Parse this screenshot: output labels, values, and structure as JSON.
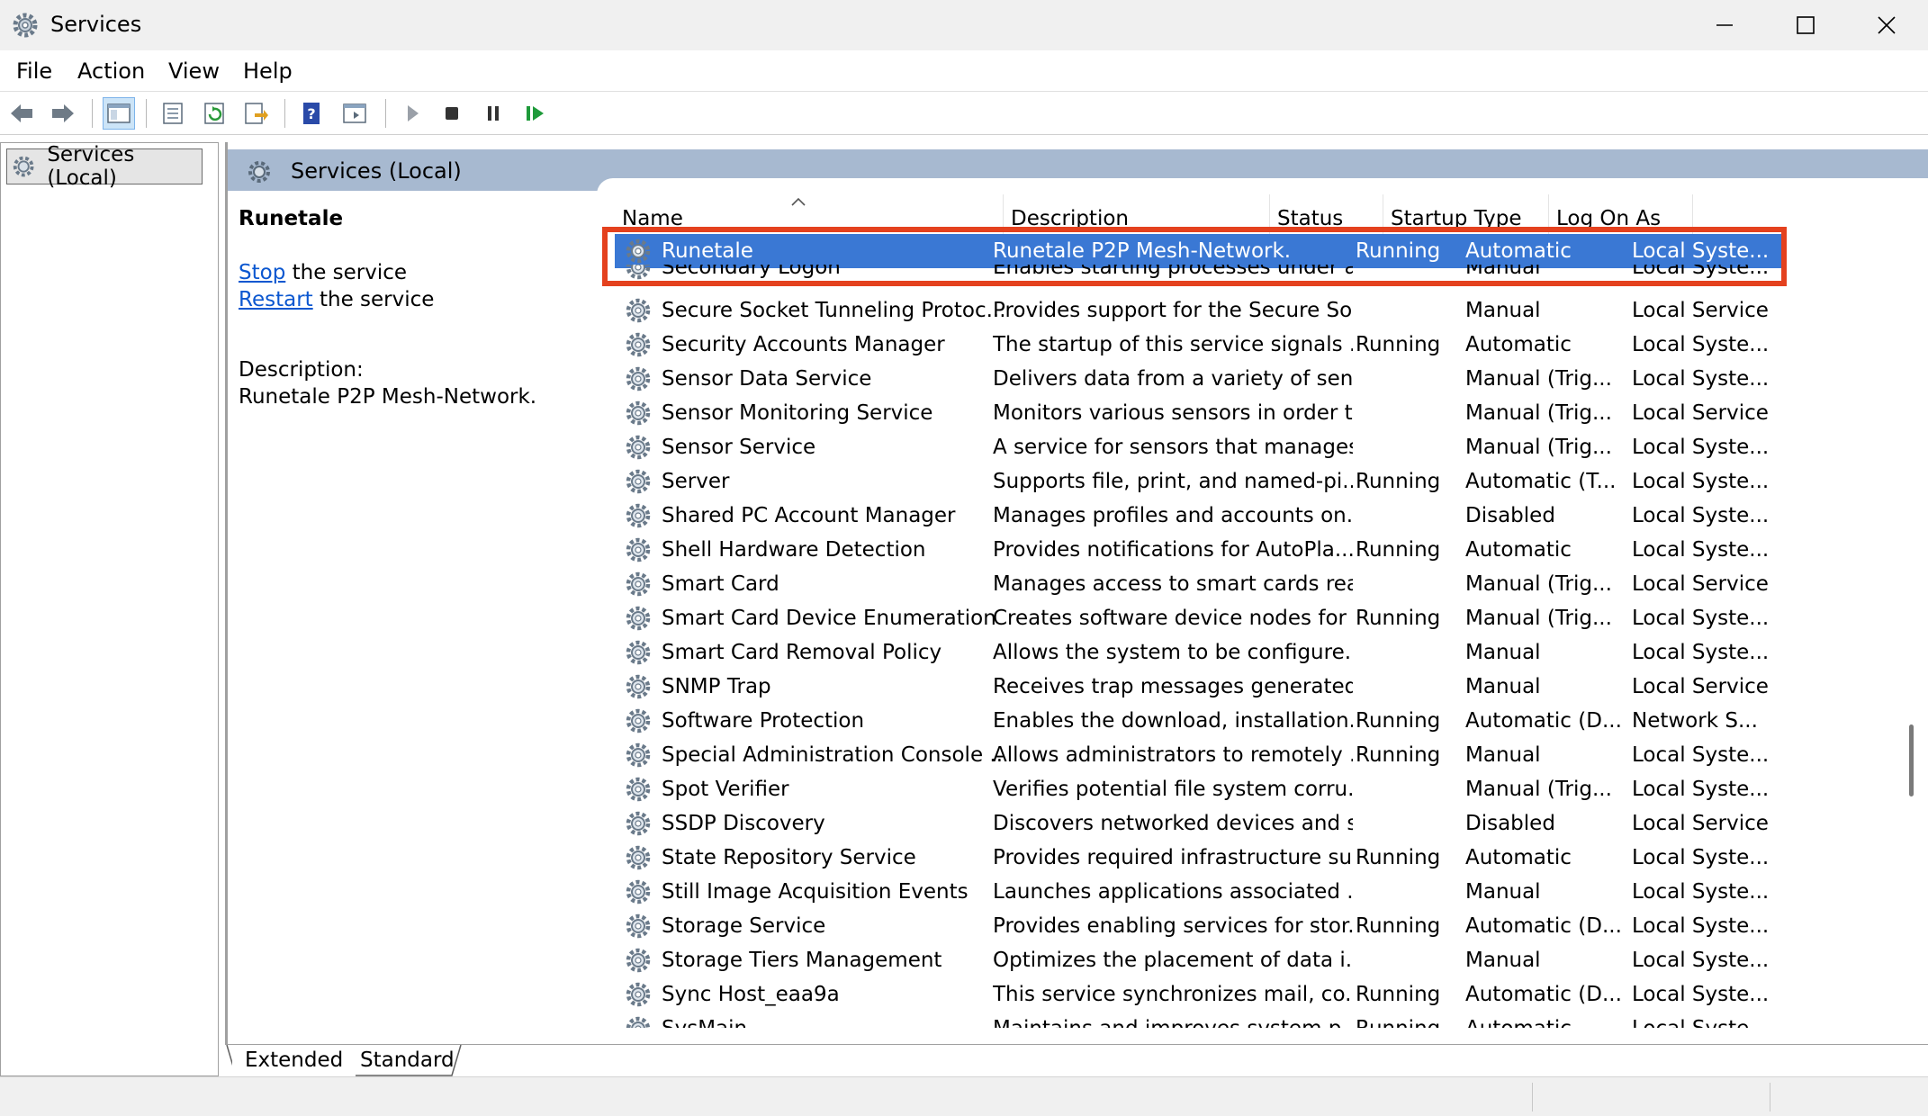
{
  "window": {
    "title": "Services",
    "icon": "services-gear-icon",
    "controls": [
      "minimize-icon",
      "maximize-icon",
      "close-icon"
    ]
  },
  "menu": [
    "File",
    "Action",
    "View",
    "Help"
  ],
  "toolbar": {
    "buttons": [
      "back-icon",
      "forward-icon",
      "show-console-tree-icon",
      "properties-icon",
      "refresh-icon",
      "export-list-icon",
      "help-icon",
      "console-view-icon",
      "start-service-icon",
      "stop-service-icon",
      "pause-service-icon",
      "resume-service-icon"
    ]
  },
  "tree": {
    "root_label": "Services (Local)"
  },
  "panel": {
    "header_title": "Services (Local)",
    "selected_name": "Runetale",
    "action_stop_link": "Stop",
    "action_stop_suffix": " the service",
    "action_restart_link": "Restart",
    "action_restart_suffix": " the service",
    "description_label": "Description:",
    "description_text": "Runetale P2P Mesh-Network."
  },
  "columns": {
    "name": "Name",
    "description": "Description",
    "status": "Status",
    "startup_type": "Startup Type",
    "log_on_as": "Log On As"
  },
  "services": [
    {
      "name": "Runetale",
      "description": "Runetale P2P Mesh-Network.",
      "status": "Running",
      "startup": "Automatic",
      "logon": "Local Syste...",
      "selected": true
    },
    {
      "name": "Secondary Logon",
      "description": "Enables starting processes under a...",
      "status": "",
      "startup": "Manual",
      "logon": "Local Syste...",
      "cut": true
    },
    {
      "name": "Secure Socket Tunneling Protoc...",
      "description": "Provides support for the Secure So...",
      "status": "",
      "startup": "Manual",
      "logon": "Local Service"
    },
    {
      "name": "Security Accounts Manager",
      "description": "The startup of this service signals ...",
      "status": "Running",
      "startup": "Automatic",
      "logon": "Local Syste..."
    },
    {
      "name": "Sensor Data Service",
      "description": "Delivers data from a variety of sen...",
      "status": "",
      "startup": "Manual (Trig...",
      "logon": "Local Syste..."
    },
    {
      "name": "Sensor Monitoring Service",
      "description": "Monitors various sensors in order t...",
      "status": "",
      "startup": "Manual (Trig...",
      "logon": "Local Service"
    },
    {
      "name": "Sensor Service",
      "description": "A service for sensors that manages...",
      "status": "",
      "startup": "Manual (Trig...",
      "logon": "Local Syste..."
    },
    {
      "name": "Server",
      "description": "Supports file, print, and named-pi...",
      "status": "Running",
      "startup": "Automatic (T...",
      "logon": "Local Syste..."
    },
    {
      "name": "Shared PC Account Manager",
      "description": "Manages profiles and accounts on...",
      "status": "",
      "startup": "Disabled",
      "logon": "Local Syste..."
    },
    {
      "name": "Shell Hardware Detection",
      "description": "Provides notifications for AutoPla...",
      "status": "Running",
      "startup": "Automatic",
      "logon": "Local Syste..."
    },
    {
      "name": "Smart Card",
      "description": "Manages access to smart cards rea...",
      "status": "",
      "startup": "Manual (Trig...",
      "logon": "Local Service"
    },
    {
      "name": "Smart Card Device Enumeration ...",
      "description": "Creates software device nodes for ...",
      "status": "Running",
      "startup": "Manual (Trig...",
      "logon": "Local Syste..."
    },
    {
      "name": "Smart Card Removal Policy",
      "description": "Allows the system to be configure...",
      "status": "",
      "startup": "Manual",
      "logon": "Local Syste..."
    },
    {
      "name": "SNMP Trap",
      "description": "Receives trap messages generated ...",
      "status": "",
      "startup": "Manual",
      "logon": "Local Service"
    },
    {
      "name": "Software Protection",
      "description": "Enables the download, installation...",
      "status": "Running",
      "startup": "Automatic (D...",
      "logon": "Network S..."
    },
    {
      "name": "Special Administration Console ...",
      "description": "Allows administrators to remotely ...",
      "status": "Running",
      "startup": "Manual",
      "logon": "Local Syste..."
    },
    {
      "name": "Spot Verifier",
      "description": "Verifies potential file system corru...",
      "status": "",
      "startup": "Manual (Trig...",
      "logon": "Local Syste..."
    },
    {
      "name": "SSDP Discovery",
      "description": "Discovers networked devices and s...",
      "status": "",
      "startup": "Disabled",
      "logon": "Local Service"
    },
    {
      "name": "State Repository Service",
      "description": "Provides required infrastructure su...",
      "status": "Running",
      "startup": "Automatic",
      "logon": "Local Syste..."
    },
    {
      "name": "Still Image Acquisition Events",
      "description": "Launches applications associated ...",
      "status": "",
      "startup": "Manual",
      "logon": "Local Syste..."
    },
    {
      "name": "Storage Service",
      "description": "Provides enabling services for stor...",
      "status": "Running",
      "startup": "Automatic (D...",
      "logon": "Local Syste..."
    },
    {
      "name": "Storage Tiers Management",
      "description": "Optimizes the placement of data i...",
      "status": "",
      "startup": "Manual",
      "logon": "Local Syste..."
    },
    {
      "name": "Sync Host_eaa9a",
      "description": "This service synchronizes mail, co...",
      "status": "Running",
      "startup": "Automatic (D...",
      "logon": "Local Syste..."
    },
    {
      "name": "SysMain",
      "description": "Maintains and improves system p...",
      "status": "Running",
      "startup": "Automatic",
      "logon": "Local Syste...",
      "cut": true
    }
  ],
  "tabs": [
    "Extended",
    "Standard"
  ],
  "colors": {
    "selection": "#3a78d4",
    "highlight_border": "#e4411e",
    "panel_header": "#a7b9d0",
    "link": "#0b57d0"
  }
}
